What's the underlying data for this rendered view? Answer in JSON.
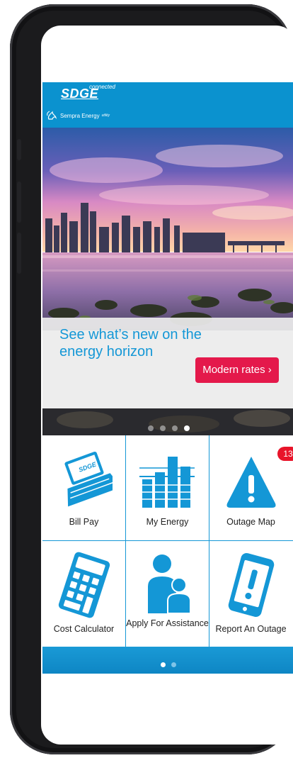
{
  "header": {
    "logo_text": "SDGE",
    "logo_connected": "connected",
    "sempra_text": "Sempra Energy",
    "sempra_small": "utility"
  },
  "carousel": {
    "promo_text": "See what’s new on the energy horizon",
    "button_label": "Modern rates ›",
    "slide_count": 4,
    "active_slide": 4,
    "accent_color": "#1497d6",
    "button_color": "#e4194b"
  },
  "tiles": [
    {
      "label": "Bill Pay",
      "icon": "laptop-bill-icon"
    },
    {
      "label": "My Energy",
      "icon": "bar-chart-icon"
    },
    {
      "label": "Outage Map",
      "icon": "warning-triangle-icon",
      "badge": "13"
    },
    {
      "label": "Cost Calculator",
      "icon": "calculator-icon"
    },
    {
      "label": "Apply For Assistance",
      "icon": "people-icon"
    },
    {
      "label": "Report An Outage",
      "icon": "phone-alert-icon"
    }
  ],
  "pager": {
    "pages": 2,
    "active_page": 1
  },
  "colors": {
    "brand_blue": "#0b92cf",
    "badge_red": "#e8142a"
  }
}
